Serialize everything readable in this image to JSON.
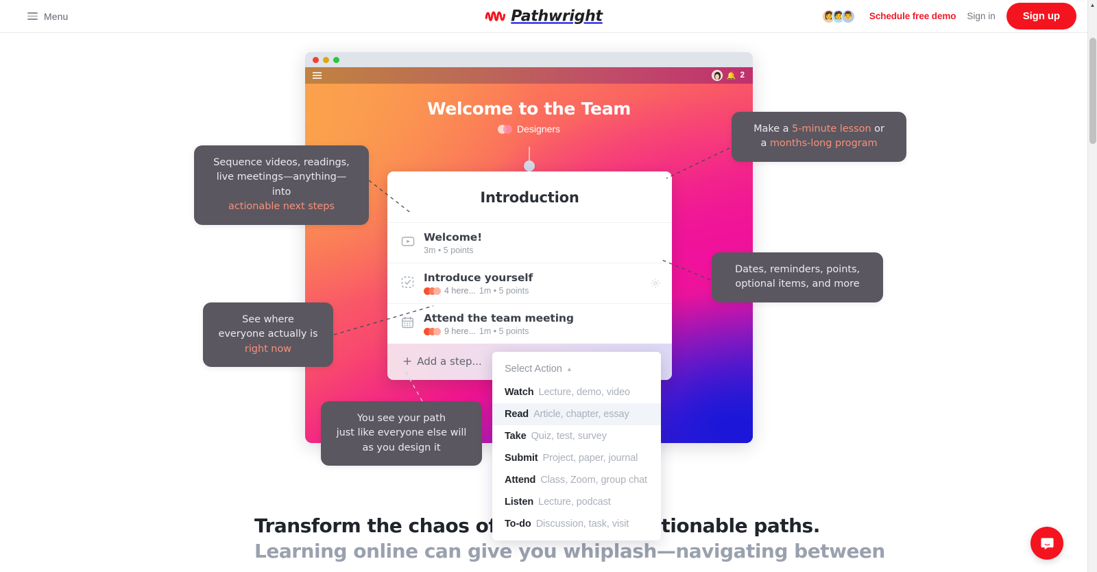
{
  "topnav": {
    "menu_label": "Menu",
    "brand_name": "Pathwright",
    "demo_link": "Schedule free demo",
    "signin_link": "Sign in",
    "signup_button": "Sign up",
    "accent_red": "#f4141f"
  },
  "app_window": {
    "notification_count": "2",
    "course_title": "Welcome to the Team",
    "course_subtitle": "Designers",
    "path_title": "Introduction",
    "steps": [
      {
        "icon": "video-play-icon",
        "title": "Welcome!",
        "people": "",
        "duration": "3m",
        "points": "5 points",
        "meta": "3m • 5 points"
      },
      {
        "icon": "task-check-icon",
        "title": "Introduce yourself",
        "people": "4 here...",
        "duration": "1m",
        "points": "5 points",
        "meta": "1m • 5 points"
      },
      {
        "icon": "calendar-icon",
        "title": "Attend the team meeting",
        "people": "9 here...",
        "duration": "1m",
        "points": "5 points",
        "meta": "1m • 5 points"
      }
    ],
    "add_step_label": "Add a step..."
  },
  "dropdown": {
    "header": "Select Action",
    "items": [
      {
        "verb": "Watch",
        "hint": "Lecture, demo, video",
        "active": false
      },
      {
        "verb": "Read",
        "hint": "Article, chapter, essay",
        "active": true
      },
      {
        "verb": "Take",
        "hint": "Quiz, test, survey",
        "active": false
      },
      {
        "verb": "Submit",
        "hint": "Project, paper, journal",
        "active": false
      },
      {
        "verb": "Attend",
        "hint": "Class, Zoom, group chat",
        "active": false
      },
      {
        "verb": "Listen",
        "hint": "Lecture, podcast",
        "active": false
      },
      {
        "verb": "To-do",
        "hint": "Discussion, task, visit",
        "active": false
      }
    ]
  },
  "callouts": {
    "sequence": {
      "line1": "Sequence videos, readings,",
      "line2": "live meetings—anything—into",
      "line3_highlight": "actionable next steps"
    },
    "lesson": {
      "line1_pre": "Make a ",
      "line1_highlight": "5-minute lesson",
      "line1_post": " or",
      "line2_pre": "a ",
      "line2_highlight": "months-long program"
    },
    "dates": {
      "line1": "Dates, reminders, points,",
      "line2": "optional items, and more"
    },
    "seewhere": {
      "line1": "See where",
      "line2": "everyone actually is",
      "line3_highlight": "right now"
    },
    "yourpath": {
      "line1": "You see your path",
      "line2": "just like everyone else will",
      "line3": "as you design it"
    },
    "highlight_color": "#f8907a"
  },
  "headline": {
    "line1": "Transform the chaos of content into actionable paths.",
    "line2": "Learning online can give you whiplash—navigating between"
  },
  "chat": {
    "launcher_label": "Open chat"
  }
}
